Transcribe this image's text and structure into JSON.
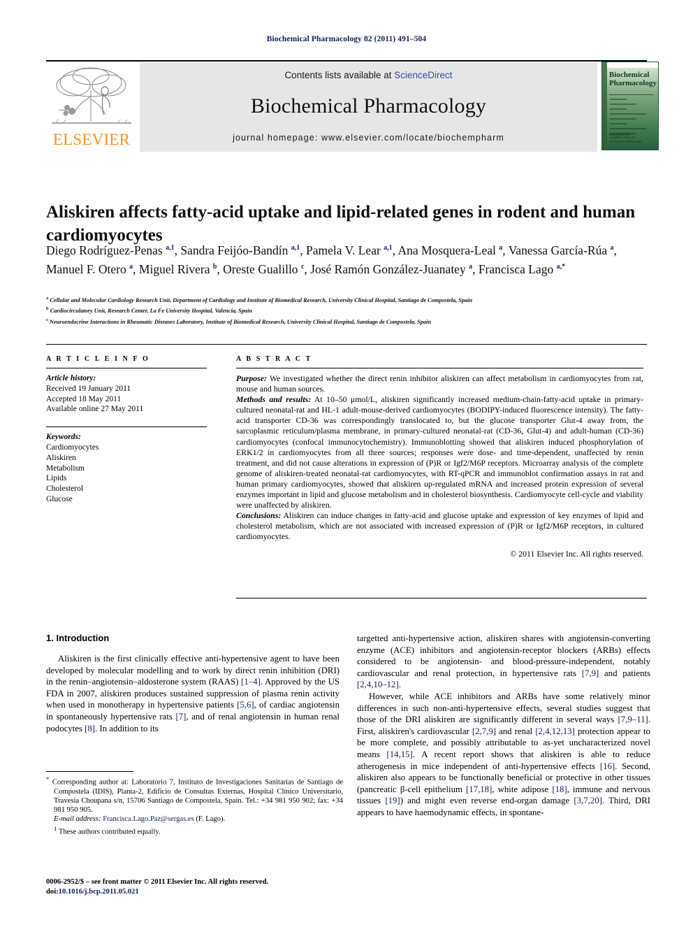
{
  "running_head": "Biochemical Pharmacology 82 (2011) 491–504",
  "header": {
    "contents_prefix": "Contents lists available at ",
    "sciencedirect": "ScienceDirect",
    "journal_name": "Biochemical Pharmacology",
    "homepage": "journal homepage: www.elsevier.com/locate/biochempharm",
    "publisher_logo_text": "ELSEVIER",
    "cover": {
      "title_line1": "Biochemical",
      "title_line2": "Pharmacology",
      "footer_text": "Available online at www.sciencedirect.com",
      "sd_text": "ScienceDirect"
    },
    "link_color": "#2f4fa8",
    "band_color": "#e6e6e6",
    "elsevier_orange": "#f7941e",
    "cover_green": "#3e7a4e"
  },
  "article": {
    "title": "Aliskiren affects fatty-acid uptake and lipid-related genes in rodent and human cardiomyocytes",
    "authors_html": "Diego Rodríguez-Penas <sup>a,1</sup>, Sandra Feijóo-Bandín <sup>a,1</sup>, Pamela V. Lear <sup>a,1</sup>, Ana Mosquera-Leal <sup>a</sup>, Vanessa García-Rúa <sup>a</sup>, Manuel F. Otero <sup>a</sup>, Miguel Rivera <sup>b</sup>, Oreste Gualillo <sup>c</sup>, José Ramón González-Juanatey <sup>a</sup>, Francisca Lago <sup>a,*</sup>",
    "affiliations": [
      {
        "marker": "a",
        "text": "Cellular and Molecular Cardiology Research Unit, Department of Cardiology and Institute of Biomedical Research, University Clinical Hospital, Santiago de Compostela, Spain"
      },
      {
        "marker": "b",
        "text": "Cardiocirculatory Unit, Research Center, La Fe University Hospital, Valencia, Spain"
      },
      {
        "marker": "c",
        "text": "Neuroendocrine Interactions in Rheumatic Diseases Laboratory, Institute of Biomedical Research, University Clinical Hospital, Santiago de Compostela, Spain"
      }
    ]
  },
  "article_info": {
    "label": "A R T I C L E  I N F O",
    "history_label": "Article history:",
    "history": [
      "Received 19 January 2011",
      "Accepted 18 May 2011",
      "Available online 27 May 2011"
    ],
    "keywords_label": "Keywords:",
    "keywords": [
      "Cardiomyocytes",
      "Aliskiren",
      "Metabolism",
      "Lipids",
      "Cholesterol",
      "Glucose"
    ]
  },
  "abstract": {
    "label": "A B S T R A C T",
    "purpose_label": "Purpose:",
    "purpose_text": " We investigated whether the direct renin inhibitor aliskiren can affect metabolism in cardiomyocytes from rat, mouse and human sources.",
    "methods_label": "Methods and results:",
    "methods_text": " At 10–50 μmol/L, aliskiren significantly increased medium-chain-fatty-acid uptake in primary-cultured neonatal-rat and HL-1 adult-mouse-derived cardiomyocytes (BODIPY-induced fluorescence intensity). The fatty-acid transporter CD-36 was correspondingly translocated to, but the glucose transporter Glut-4 away from, the sarcoplasmic reticulum/plasma membrane, in primary-cultured neonatal-rat (CD-36, Glut-4) and adult-human (CD-36) cardiomyocytes (confocal immunocytochemistry). Immunoblotting showed that aliskiren induced phosphorylation of ERK1/2 in cardiomyocytes from all three sources; responses were dose- and time-dependent, unaffected by renin treatment, and did not cause alterations in expression of (P)R or Igf2/M6P receptors. Microarray analysis of the complete genome of aliskiren-treated neonatal-rat cardiomyocytes, with RT-qPCR and immunoblot confirmation assays in rat and human primary cardiomyocytes, showed that aliskiren up-regulated mRNA and increased protein expression of several enzymes important in lipid and glucose metabolism and in cholesterol biosynthesis. Cardiomyocyte cell-cycle and viability were unaffected by aliskiren.",
    "conclusions_label": "Conclusions:",
    "conclusions_text": " Aliskiren can induce changes in fatty-acid and glucose uptake and expression of key enzymes of lipid and cholesterol metabolism, which are not associated with increased expression of (P)R or Igf2/M6P receptors, in cultured cardiomyocytes.",
    "copyright": "© 2011 Elsevier Inc. All rights reserved."
  },
  "body": {
    "section_heading": "1. Introduction",
    "left_paragraph_html": "Aliskiren is the first clinically effective anti-hypertensive agent to have been developed by molecular modelling and to work by direct renin inhibition (DRI) in the renin–angiotensin–aldosterone system (RAAS) <span class=\"ref\">[1–4]</span>. Approved by the US FDA in 2007, aliskiren produces sustained suppression of plasma renin activity when used in monotherapy in hypertensive patients <span class=\"ref\">[5,6]</span>, of cardiac angiotensin in spontaneously hypertensive rats <span class=\"ref\">[7]</span>, and of renal angiotensin in human renal podocytes <span class=\"ref\">[8]</span>. In addition to its",
    "right_paragraph1_html": "targetted anti-hypertensive action, aliskiren shares with angiotensin-converting enzyme (ACE) inhibitors and angiotensin-receptor blockers (ARBs) effects considered to be angiotensin- and blood-pressure-independent, notably cardiovascular and renal protection, in hypertensive rats <span class=\"ref\">[7,9]</span> and patients <span class=\"ref\">[2,4,10–12]</span>.",
    "right_paragraph2_html": "However, while ACE inhibitors and ARBs have some relatively minor differences in such non-anti-hypertensive effects, several studies suggest that those of the DRI aliskiren are significantly different in several ways <span class=\"ref\">[7,9–11]</span>. First, aliskiren's cardiovascular <span class=\"ref\">[2,7,9]</span> and renal <span class=\"ref\">[2,4,12,13]</span> protection appear to be more complete, and possibly attributable to as-yet uncharacterized novel means <span class=\"ref\">[14,15]</span>. A recent report shows that aliskiren is able to reduce atherogenesis in mice independent of anti-hypertensive effects <span class=\"ref\">[16]</span>. Second, aliskiren also appears to be functionally beneficial or protective in other tissues (pancreatic β-cell epithelium <span class=\"ref\">[17,18]</span>, white adipose <span class=\"ref\">[18]</span>, immune and nervous tissues <span class=\"ref\">[19]</span>) and might even reverse end-organ damage <span class=\"ref\">[3,7,20]</span>. Third, DRI appears to have haemodynamic effects, in spontane-"
  },
  "footnotes": {
    "corresponding_html": "<sup>*</sup> Corresponding author at: Laboratorio 7, Instituto de Investigaciones Sanitarias de Santiago de Compostela (IDIS), Planta-2, Edificio de Consultas Externas, Hospital Clínico Universitario, Travesia Choupana s/n, 15706 Santiago de Compostela, Spain. Tel.: +34 981 950 902; fax: +34 981 950 905.",
    "email_label": "E-mail address:",
    "email": "Francisca.Lago.Paz@sergas.es",
    "email_suffix": " (F. Lago).",
    "equal_contrib_html": "<sup>1</sup> These authors contributed equally.",
    "issn_line": "0006-2952/$ – see front matter © 2011 Elsevier Inc. All rights reserved.",
    "doi_label": "doi:",
    "doi": "10.1016/j.bcp.2011.05.021"
  }
}
